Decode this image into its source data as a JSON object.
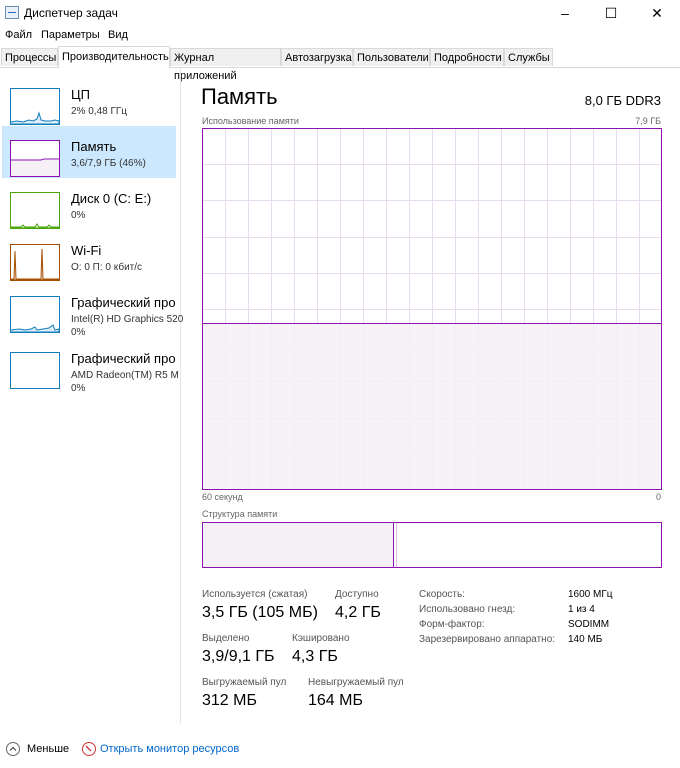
{
  "window": {
    "title": "Диспетчер задач",
    "controls": {
      "minimize": "–",
      "maximize": "☐",
      "close": "✕"
    }
  },
  "menu": [
    "Файл",
    "Параметры",
    "Вид"
  ],
  "tabs": [
    {
      "label": "Процессы",
      "active": false
    },
    {
      "label": "Производительность",
      "active": true
    },
    {
      "label": "Журнал приложений",
      "active": false
    },
    {
      "label": "Автозагрузка",
      "active": false
    },
    {
      "label": "Пользователи",
      "active": false
    },
    {
      "label": "Подробности",
      "active": false
    },
    {
      "label": "Службы",
      "active": false
    }
  ],
  "sidebar": {
    "items": [
      {
        "title": "ЦП",
        "sub1": "2% 0,48 ГГц",
        "sub2": "",
        "color": "#117dbb"
      },
      {
        "title": "Память",
        "sub1": "3,6/7,9 ГБ (46%)",
        "sub2": "",
        "color": "#8b12ae"
      },
      {
        "title": "Диск 0 (C: E:)",
        "sub1": "0%",
        "sub2": "",
        "color": "#4da60c"
      },
      {
        "title": "Wi-Fi",
        "sub1": "О: 0 П: 0 кбит/с",
        "sub2": "",
        "color": "#a74f01"
      },
      {
        "title": "Графический про",
        "sub1": "Intel(R) HD Graphics 520",
        "sub2": "0%",
        "color": "#117dbb"
      },
      {
        "title": "Графический про",
        "sub1": "AMD Radeon(TM) R5 M",
        "sub2": "0%",
        "color": "#117dbb"
      }
    ]
  },
  "main": {
    "title": "Память",
    "spec": "8,0 ГБ DDR3",
    "usage_label": "Использование памяти",
    "usage_max": "7,9 ГБ",
    "usage_fraction": 0.46,
    "time_label": "60 секунд",
    "time_zero": "0",
    "structure_label": "Структура памяти",
    "structure_used_fraction": 0.46,
    "stats": {
      "in_use_label": "Используется (сжатая)",
      "in_use_value": "3,5 ГБ (105 МБ)",
      "available_label": "Доступно",
      "available_value": "4,2 ГБ",
      "committed_label": "Выделено",
      "committed_value": "3,9/9,1 ГБ",
      "cached_label": "Кэшировано",
      "cached_value": "4,3 ГБ",
      "paged_label": "Выгружаемый пул",
      "paged_value": "312 МБ",
      "nonpaged_label": "Невыгружаемый пул",
      "nonpaged_value": "164 МБ"
    },
    "specs": {
      "speed_label": "Скорость:",
      "speed_value": "1600 МГц",
      "slots_label": "Использовано гнезд:",
      "slots_value": "1 из 4",
      "form_label": "Форм-фактор:",
      "form_value": "SODIMM",
      "reserved_label": "Зарезервировано аппаратно:",
      "reserved_value": "140 МБ"
    }
  },
  "footer": {
    "fewer_label": "Меньше",
    "monitor_label": "Открыть монитор ресурсов"
  },
  "colors": {
    "memory_accent": "#8b12ae",
    "memory_fill": "#f4f0f5",
    "grid": "#e9dbee",
    "selection": "#cce8ff",
    "link": "#0066cc"
  }
}
